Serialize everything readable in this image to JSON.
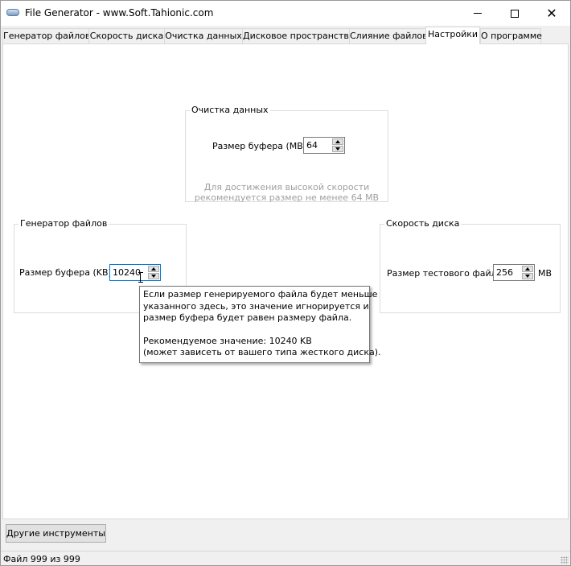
{
  "window": {
    "title": "File Generator  -  www.Soft.Tahionic.com"
  },
  "tabs": [
    {
      "label": "Генератор файлов"
    },
    {
      "label": "Скорость диска"
    },
    {
      "label": "Очистка данных"
    },
    {
      "label": "Дисковое пространство"
    },
    {
      "label": "Слияние файлов"
    },
    {
      "label": "Настройки"
    },
    {
      "label": "О программе"
    }
  ],
  "active_tab": "Настройки",
  "wipe_group": {
    "title": "Очистка данных",
    "buffer_label": "Размер буфера (MB):",
    "buffer_value": "64",
    "hint_line1": "Для достижения высокой скорости",
    "hint_line2": "рекомендуется размер не менее 64 MB"
  },
  "generator_group": {
    "title": "Генератор файлов",
    "buffer_label": "Размер буфера (KB):",
    "buffer_value": "10240"
  },
  "speed_group": {
    "title": "Скорость диска",
    "test_file_label": "Размер тестового файла:",
    "test_file_value": "256",
    "unit": "MB"
  },
  "tooltip": {
    "line1": "Если размер генерируемого файла будет меньше",
    "line2": "указанного здесь, это значение игнорируется и",
    "line3": "размер буфера будет равен размеру файла.",
    "line4": "Рекомендуемое значение: 10240 KB",
    "line5": "(может зависеть от вашего типа жесткого диска)."
  },
  "other_tools_button": "Другие инструменты",
  "status": "Файл 999 из 999",
  "colors": {
    "focus_border": "#0078d7",
    "disabled_text": "#a0a0a0",
    "window_bg": "#f0f0f0"
  }
}
